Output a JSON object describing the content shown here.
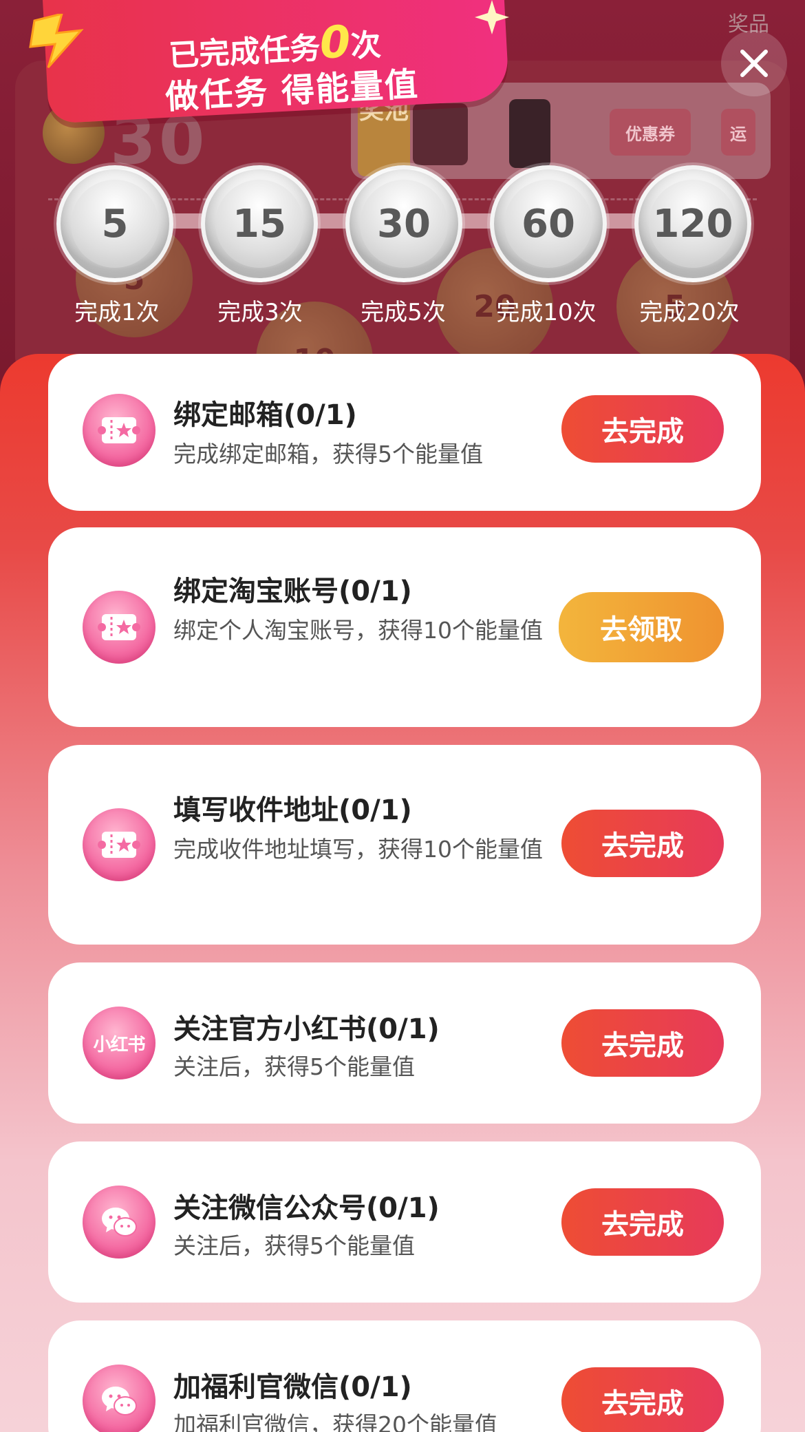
{
  "header": {
    "top_right_label": "奖品",
    "banner_prefix": "已完成任务",
    "banner_count": "0",
    "banner_suffix": "次",
    "banner_subtitle": "做任务 得能量值",
    "background_score": "30",
    "prize_pool_tag": "奖池",
    "coupon_label": "优惠券",
    "next_prize_label": "运"
  },
  "milestones": [
    {
      "value": "5",
      "label": "完成1次"
    },
    {
      "value": "15",
      "label": "完成3次"
    },
    {
      "value": "30",
      "label": "完成5次"
    },
    {
      "value": "60",
      "label": "完成10次"
    },
    {
      "value": "120",
      "label": "完成20次"
    }
  ],
  "background_coins": [
    "5",
    "10",
    "20",
    "5"
  ],
  "tasks": [
    {
      "title": "绑定邮箱(0/1)",
      "desc": "完成绑定邮箱，获得5个能量值",
      "button": "去完成",
      "icon": "ticket-icon"
    },
    {
      "title": "绑定淘宝账号(0/1)",
      "desc": "绑定个人淘宝账号，获得10个能量值",
      "button": "去领取",
      "icon": "ticket-icon"
    },
    {
      "title": "填写收件地址(0/1)",
      "desc": "完成收件地址填写，获得10个能量值",
      "button": "去完成",
      "icon": "ticket-icon"
    },
    {
      "title": "关注官方小红书(0/1)",
      "desc": "关注后，获得5个能量值",
      "button": "去完成",
      "icon": "xiaohongshu-icon",
      "icon_text": "小红书"
    },
    {
      "title": "关注微信公众号(0/1)",
      "desc": "关注后，获得5个能量值",
      "button": "去完成",
      "icon": "wechat-icon"
    },
    {
      "title": "加福利官微信(0/1)",
      "desc": "加福利官微信，获得20个能量值",
      "button": "去完成",
      "icon": "wechat-icon"
    }
  ],
  "colors": {
    "sheet_top": "#ec3a2f",
    "button_red": "#ee4d34",
    "button_orange": "#f3b53c",
    "banner_pink": "#f0307f",
    "count_yellow": "#ffe84a"
  }
}
